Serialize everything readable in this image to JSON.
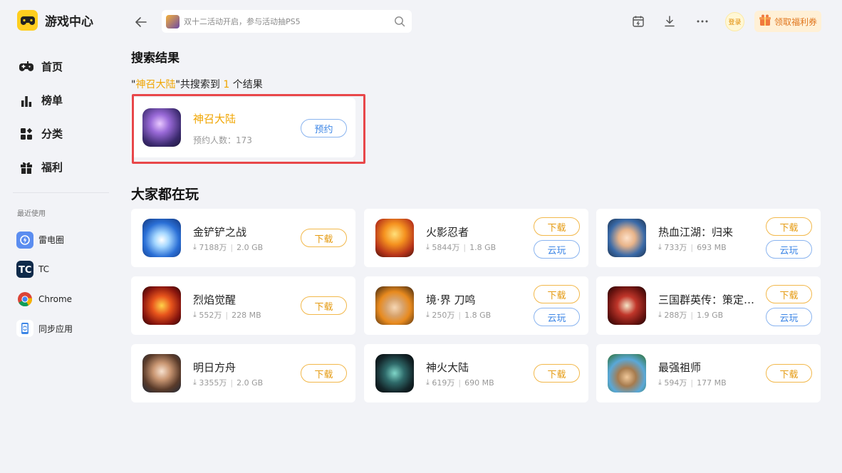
{
  "app": {
    "name": "游戏中心"
  },
  "nav": [
    {
      "label": "首页",
      "icon": "gamepad-icon"
    },
    {
      "label": "榜单",
      "icon": "ranking-icon"
    },
    {
      "label": "分类",
      "icon": "category-icon"
    },
    {
      "label": "福利",
      "icon": "gift-icon"
    }
  ],
  "recent": {
    "title": "最近使用",
    "items": [
      {
        "label": "雷电圈",
        "icon": "leidian-icon",
        "color": "#5b8df0"
      },
      {
        "label": "TC",
        "icon": "tc-icon",
        "color": "#0f2a4a"
      },
      {
        "label": "Chrome",
        "icon": "chrome-icon",
        "color": "#ffffff"
      },
      {
        "label": "同步应用",
        "icon": "sync-app-icon",
        "color": "#ffffff"
      }
    ]
  },
  "search": {
    "placeholder": "双十二活动开启，参与活动抽PS5"
  },
  "top": {
    "login": "登录",
    "coupon": "领取福利券"
  },
  "results": {
    "title": "搜索结果",
    "quote_open": "\"",
    "query": "神召大陆",
    "mid": "\"共搜索到 ",
    "count": "1",
    "tail": " 个结果",
    "game": {
      "name": "神召大陆",
      "meta": "预约人数：173",
      "button": "预约"
    }
  },
  "popular": {
    "title": "大家都在玩",
    "games": [
      {
        "name": "金铲铲之战",
        "downloads": "7188万",
        "size": "2.0 GB",
        "download": "下载",
        "cloud": ""
      },
      {
        "name": "火影忍者",
        "downloads": "5844万",
        "size": "1.8 GB",
        "download": "下载",
        "cloud": "云玩"
      },
      {
        "name": "热血江湖：归来",
        "downloads": "733万",
        "size": "693 MB",
        "download": "下载",
        "cloud": "云玩"
      },
      {
        "name": "烈焰觉醒",
        "downloads": "552万",
        "size": "228 MB",
        "download": "下载",
        "cloud": ""
      },
      {
        "name": "境·界 刀鸣",
        "downloads": "250万",
        "size": "1.8 GB",
        "download": "下载",
        "cloud": "云玩"
      },
      {
        "name": "三国群英传：策定九州",
        "downloads": "288万",
        "size": "1.9 GB",
        "download": "下载",
        "cloud": "云玩"
      },
      {
        "name": "明日方舟",
        "downloads": "3355万",
        "size": "2.0 GB",
        "download": "下载",
        "cloud": ""
      },
      {
        "name": "神火大陆",
        "downloads": "619万",
        "size": "690 MB",
        "download": "下载",
        "cloud": ""
      },
      {
        "name": "最强祖师",
        "downloads": "594万",
        "size": "177 MB",
        "download": "下载",
        "cloud": ""
      }
    ]
  }
}
